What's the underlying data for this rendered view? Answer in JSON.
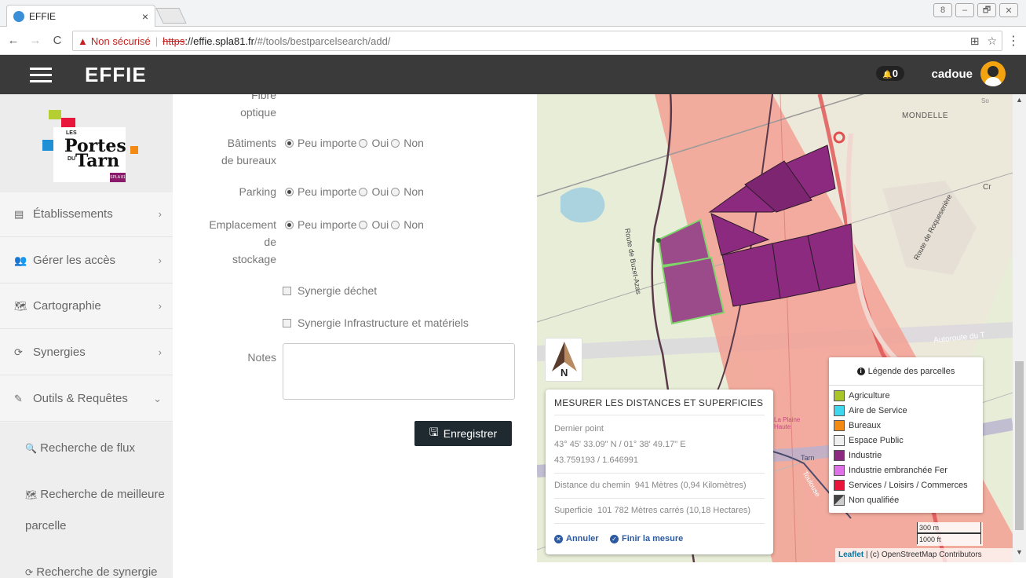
{
  "browser": {
    "tab_title": "EFFIE",
    "tab_close": "×",
    "window_buttons": [
      "8",
      "–",
      "🗗",
      "✕"
    ],
    "back": "←",
    "forward": "→",
    "reload": "C",
    "warning_icon": "▲",
    "not_secure": "Non sécurisé",
    "separator": "|",
    "url_scheme": "https",
    "url_host": "://effie.spla81.fr",
    "url_path": "/#/tools/bestparcelsearch/add/",
    "translate_icon": "⊞",
    "star_icon": "☆",
    "menu_icon": "⋮"
  },
  "appbar": {
    "title": "EFFIE",
    "notification_count": "0",
    "bell_icon": "🔔",
    "username": "cadoue"
  },
  "sidebar": {
    "logo": {
      "les": "LES",
      "portes": "Portes",
      "du": "DU",
      "tarn": "Tarn",
      "spla": "SPLA 81"
    },
    "items": [
      {
        "label": "Établissements",
        "icon": "▤",
        "chevron": "›"
      },
      {
        "label": "Gérer les accès",
        "icon": "👥",
        "chevron": "›"
      },
      {
        "label": "Cartographie",
        "icon": "🗺",
        "chevron": "›"
      },
      {
        "label": "Synergies",
        "icon": "⟳",
        "chevron": "›"
      },
      {
        "label": "Outils & Requêtes",
        "icon": "✎",
        "chevron": "⌄"
      }
    ],
    "subitems": [
      {
        "label": "Recherche de flux",
        "icon": "🔍"
      },
      {
        "label": "Recherche de meilleure",
        "icon": "🗺"
      },
      {
        "label": "parcelle",
        "icon": ""
      },
      {
        "label": "Recherche de synergie",
        "icon": "⟳"
      }
    ]
  },
  "form": {
    "fibre_label_1": "Fibre",
    "fibre_label_2": "optique",
    "fields": [
      {
        "label_lines": [
          "Bâtiments",
          "de bureaux"
        ],
        "options": [
          "Peu importe",
          "Oui",
          "Non"
        ],
        "selected": 0
      },
      {
        "label_lines": [
          "Parking"
        ],
        "options": [
          "Peu importe",
          "Oui",
          "Non"
        ],
        "selected": 0
      },
      {
        "label_lines": [
          "Emplacement",
          "de",
          "stockage"
        ],
        "options": [
          "Peu importe",
          "Oui",
          "Non"
        ],
        "selected": 0
      }
    ],
    "checkboxes": [
      "Synergie déchet",
      "Synergie Infrastructure et matériels"
    ],
    "notes_label": "Notes",
    "save_label": "Enregistrer",
    "save_icon": "🖫"
  },
  "map": {
    "labels": {
      "mondelle": "MONDELLE",
      "route_dozel": "Route de Buzet-Azas",
      "route_roque": "Route de Roqueserière",
      "autoroute": "Autoroute du T",
      "tarn": "Tarn",
      "toulouse": "Toulouse",
      "plaine": "La Plaine Haute",
      "haute": "Haute Plaine",
      "cr": "Cr",
      "so": "So"
    },
    "north_label": "N",
    "measure": {
      "title": "MESURER LES DISTANCES ET SUPERFICIES",
      "last_point_label": "Dernier point",
      "coords_dms": "43° 45' 33.09\" N / 01° 38' 49.17\" E",
      "coords_dec": "43.759193 / 1.646991",
      "distance_label": "Distance du chemin",
      "distance_value": "941 Mètres (0,94 Kilomètres)",
      "area_label": "Superficie",
      "area_value": "101 782 Mètres carrés (10,18 Hectares)",
      "cancel_label": "Annuler",
      "cancel_icon": "✕",
      "finish_label": "Finir la mesure",
      "finish_icon": "✓"
    },
    "legend": {
      "title": "Légende des parcelles",
      "info_icon": "i",
      "items": [
        {
          "label": "Agriculture",
          "color": "#a8c52a"
        },
        {
          "label": "Aire de Service",
          "color": "#3fd6ee"
        },
        {
          "label": "Bureaux",
          "color": "#f28a14"
        },
        {
          "label": "Espace Public",
          "color": "#efefef"
        },
        {
          "label": "Industrie",
          "color": "#8b2a7e"
        },
        {
          "label": "Industrie embranchée Fer",
          "color": "#e070e8"
        },
        {
          "label": "Services / Loisirs / Commerces",
          "color": "#e8163b"
        },
        {
          "label": "Non qualifiée",
          "color": "#777777"
        }
      ]
    },
    "scale_metric": "300 m",
    "scale_imperial": "1000 ft",
    "attribution_leaflet": "Leaflet",
    "attribution_rest": " | (c) OpenStreetMap Contributors"
  },
  "colors": {
    "appbar_bg": "#3a3a3a",
    "industrie": "#8b2a7e",
    "zone_overlay": "#f2a093",
    "save_btn": "#1f2a30"
  }
}
